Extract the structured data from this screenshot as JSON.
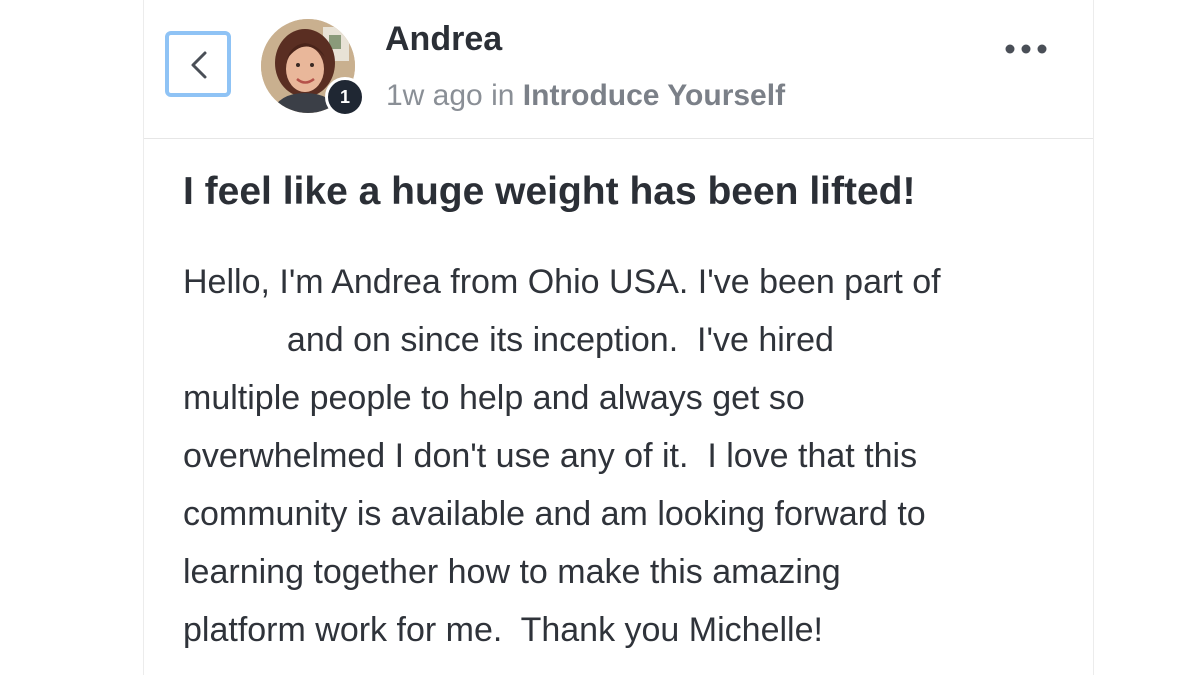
{
  "header": {
    "back_icon": "chevron-left-icon",
    "author_name": "Andrea",
    "avatar": "user-avatar-photo",
    "badge_level": "1",
    "time_ago": "1w ago",
    "in_word": "in",
    "channel": "Introduce Yourself",
    "more_icon": "more-horizontal-icon"
  },
  "post": {
    "title": "I feel like a huge weight has been lifted!",
    "lines": [
      "Hello, I'm Andrea from Ohio USA. I've been part of",
      "           and on since its inception.  I've hired",
      "multiple people to help and always get so",
      "overwhelmed I don't use any of it.  I love that this",
      "community is available and am looking forward to",
      "learning together how to make this amazing",
      "platform work for me.  Thank you Michelle!"
    ]
  },
  "colors": {
    "accent_focus": "#8fc3f5",
    "text_primary": "#2b2f36",
    "text_muted": "#8a8f96",
    "badge_bg": "#1f2733"
  }
}
